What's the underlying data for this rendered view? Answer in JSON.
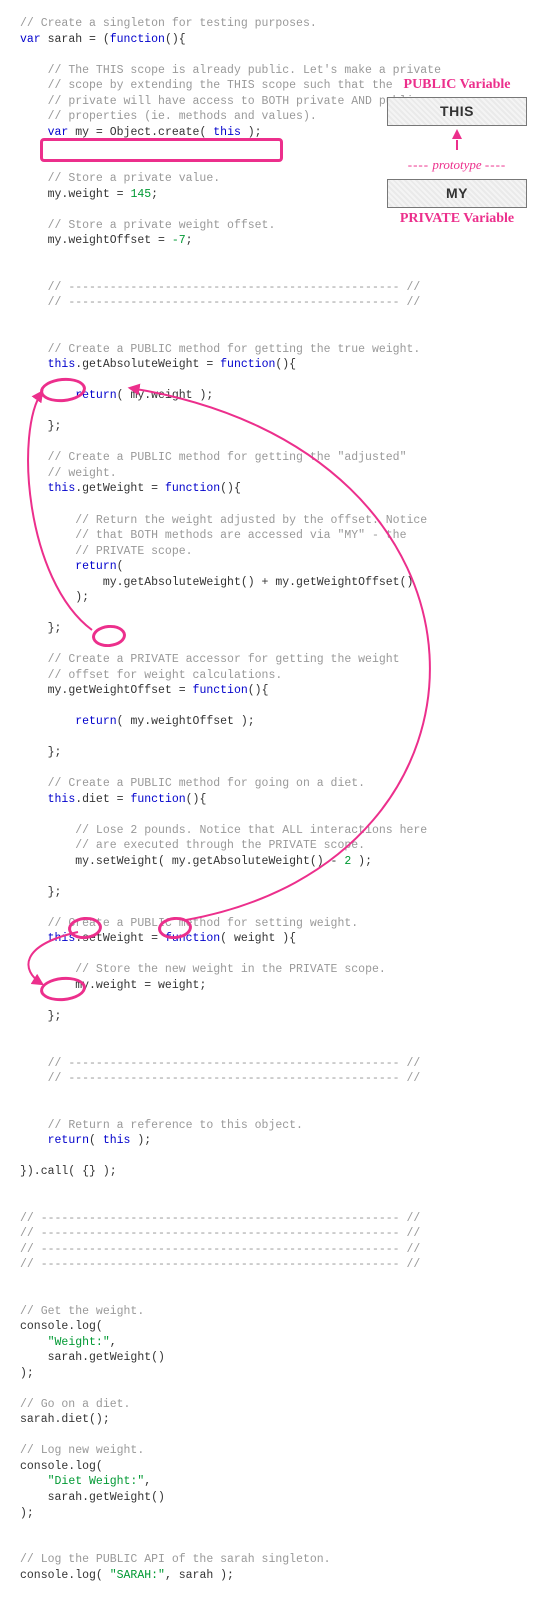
{
  "diagram": {
    "publicLabel": "PUBLIC Variable",
    "thisBox": "THIS",
    "protoLabel": "prototype",
    "myBox": "MY",
    "privateLabel": "PRIVATE Variable"
  },
  "code": {
    "l1": "// Create a singleton for testing purposes.",
    "l2a": "var",
    "l2b": " sarah = (",
    "l2c": "function",
    "l2d": "(){",
    "l4": "// The THIS scope is already public. Let's make a private",
    "l5": "// scope by extending the THIS scope such that the",
    "l6": "// private will have access to BOTH private AND public",
    "l7": "// properties (ie. methods and values).",
    "l8a": "var",
    "l8b": " my = Object.create( ",
    "l8c": "this",
    "l8d": " );",
    "l10": "// Store a private value.",
    "l11a": "my.weight = ",
    "l11b": "145",
    "l11c": ";",
    "l13": "// Store a private weight offset.",
    "l14a": "my.weightOffset = ",
    "l14b": "-7",
    "l14c": ";",
    "hr": "// ------------------------------------------------ //",
    "l19": "// Create a PUBLIC method for getting the true weight.",
    "l20a": "this",
    "l20b": ".getAbsoluteWeight = ",
    "l20c": "function",
    "l20d": "(){",
    "l22a": "return",
    "l22b": "( my.weight );",
    "l24": "};",
    "l26": "// Create a PUBLIC method for getting the \"adjusted\"",
    "l27": "// weight.",
    "l28a": "this",
    "l28b": ".getWeight = ",
    "l28c": "function",
    "l28d": "(){",
    "l30": "// Return the weight adjusted by the offset. Notice",
    "l31": "// that BOTH methods are accessed via \"MY\" - the",
    "l32": "// PRIVATE scope.",
    "l33a": "return",
    "l33b": "(",
    "l34": "my.getAbsoluteWeight() + my.getWeightOffset()",
    "l35": ");",
    "l38": "// Create a PRIVATE accessor for getting the weight",
    "l39": "// offset for weight calculations.",
    "l40a": "my.getWeightOffset = ",
    "l40c": "function",
    "l40d": "(){",
    "l42a": "return",
    "l42b": "( my.weightOffset );",
    "l46": "// Create a PUBLIC method for going on a diet.",
    "l47a": "this",
    "l47b": ".diet = ",
    "l47c": "function",
    "l47d": "(){",
    "l49": "// Lose 2 pounds. Notice that ALL interactions here",
    "l50": "// are executed through the PRIVATE scope.",
    "l51a": "my.setWeight( my.getAbsoluteWeight() - ",
    "l51b": "2",
    "l51c": " );",
    "l55": "// Create a PUBLIC method for setting weight.",
    "l56a": "this",
    "l56b": ".setWeight = ",
    "l56c": "function",
    "l56d": "( weight ){",
    "l58": "// Store the new weight in the PRIVATE scope.",
    "l59": "my.weight = weight;",
    "l66": "// Return a reference to this object.",
    "l67a": "return",
    "l67b": "( ",
    "l67c": "this",
    "l67d": " );",
    "l69": "}).call( {} );",
    "hrb": "// ---------------------------------------------------- //",
    "l75": "// Get the weight.",
    "l76": "console.log(",
    "l77": "\"Weight:\"",
    "l77b": ",",
    "l78": "sarah.getWeight()",
    "l79": ");",
    "l81": "// Go on a diet.",
    "l82": "sarah.diet();",
    "l84": "// Log new weight.",
    "l86": "\"Diet Weight:\"",
    "l86b": ",",
    "l91": "// Log the PUBLIC API of the sarah singleton.",
    "l92a": "console.log( ",
    "l92b": "\"SARAH:\"",
    "l92c": ", sarah );"
  }
}
